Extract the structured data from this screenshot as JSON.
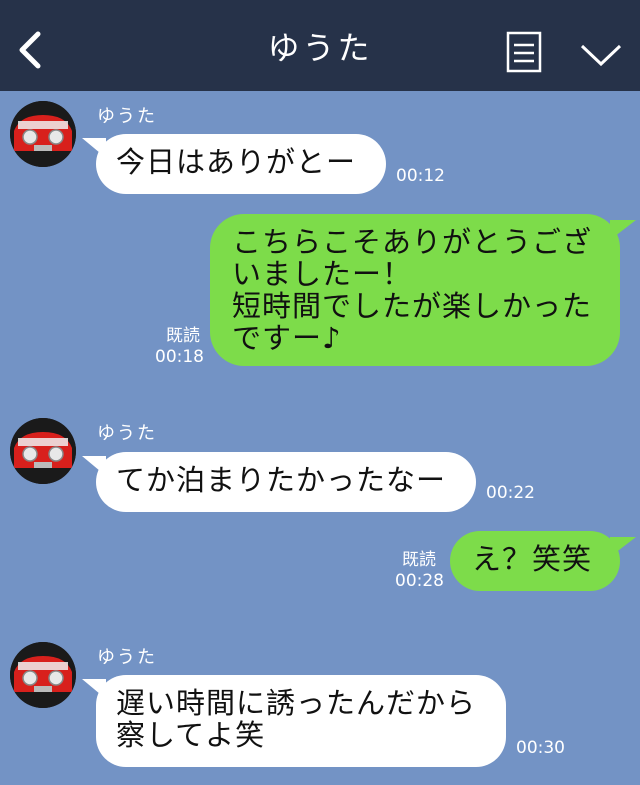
{
  "header": {
    "title": "ゆうた",
    "back_icon": "chevron-left-icon",
    "menu_icon": "list-icon",
    "expand_icon": "chevron-down-icon"
  },
  "colors": {
    "background": "#7393c5",
    "header": "#263249",
    "incoming_bubble": "#ffffff",
    "outgoing_bubble": "#7ddc4a"
  },
  "messages": [
    {
      "direction": "incoming",
      "sender": "ゆうた",
      "text": "今日はありがとー",
      "time": "00:12"
    },
    {
      "direction": "outgoing",
      "text": "こちらこそありがとうございましたー！\n短時間でしたが楽しかったですー♪",
      "read": "既読",
      "time": "00:18"
    },
    {
      "direction": "incoming",
      "sender": "ゆうた",
      "text": "てか泊まりたかったなー",
      "time": "00:22"
    },
    {
      "direction": "outgoing",
      "text": "え？笑笑",
      "read": "既読",
      "time": "00:28"
    },
    {
      "direction": "incoming",
      "sender": "ゆうた",
      "text": "遅い時間に誘ったんだから\n察してよ笑",
      "time": "00:30"
    }
  ]
}
